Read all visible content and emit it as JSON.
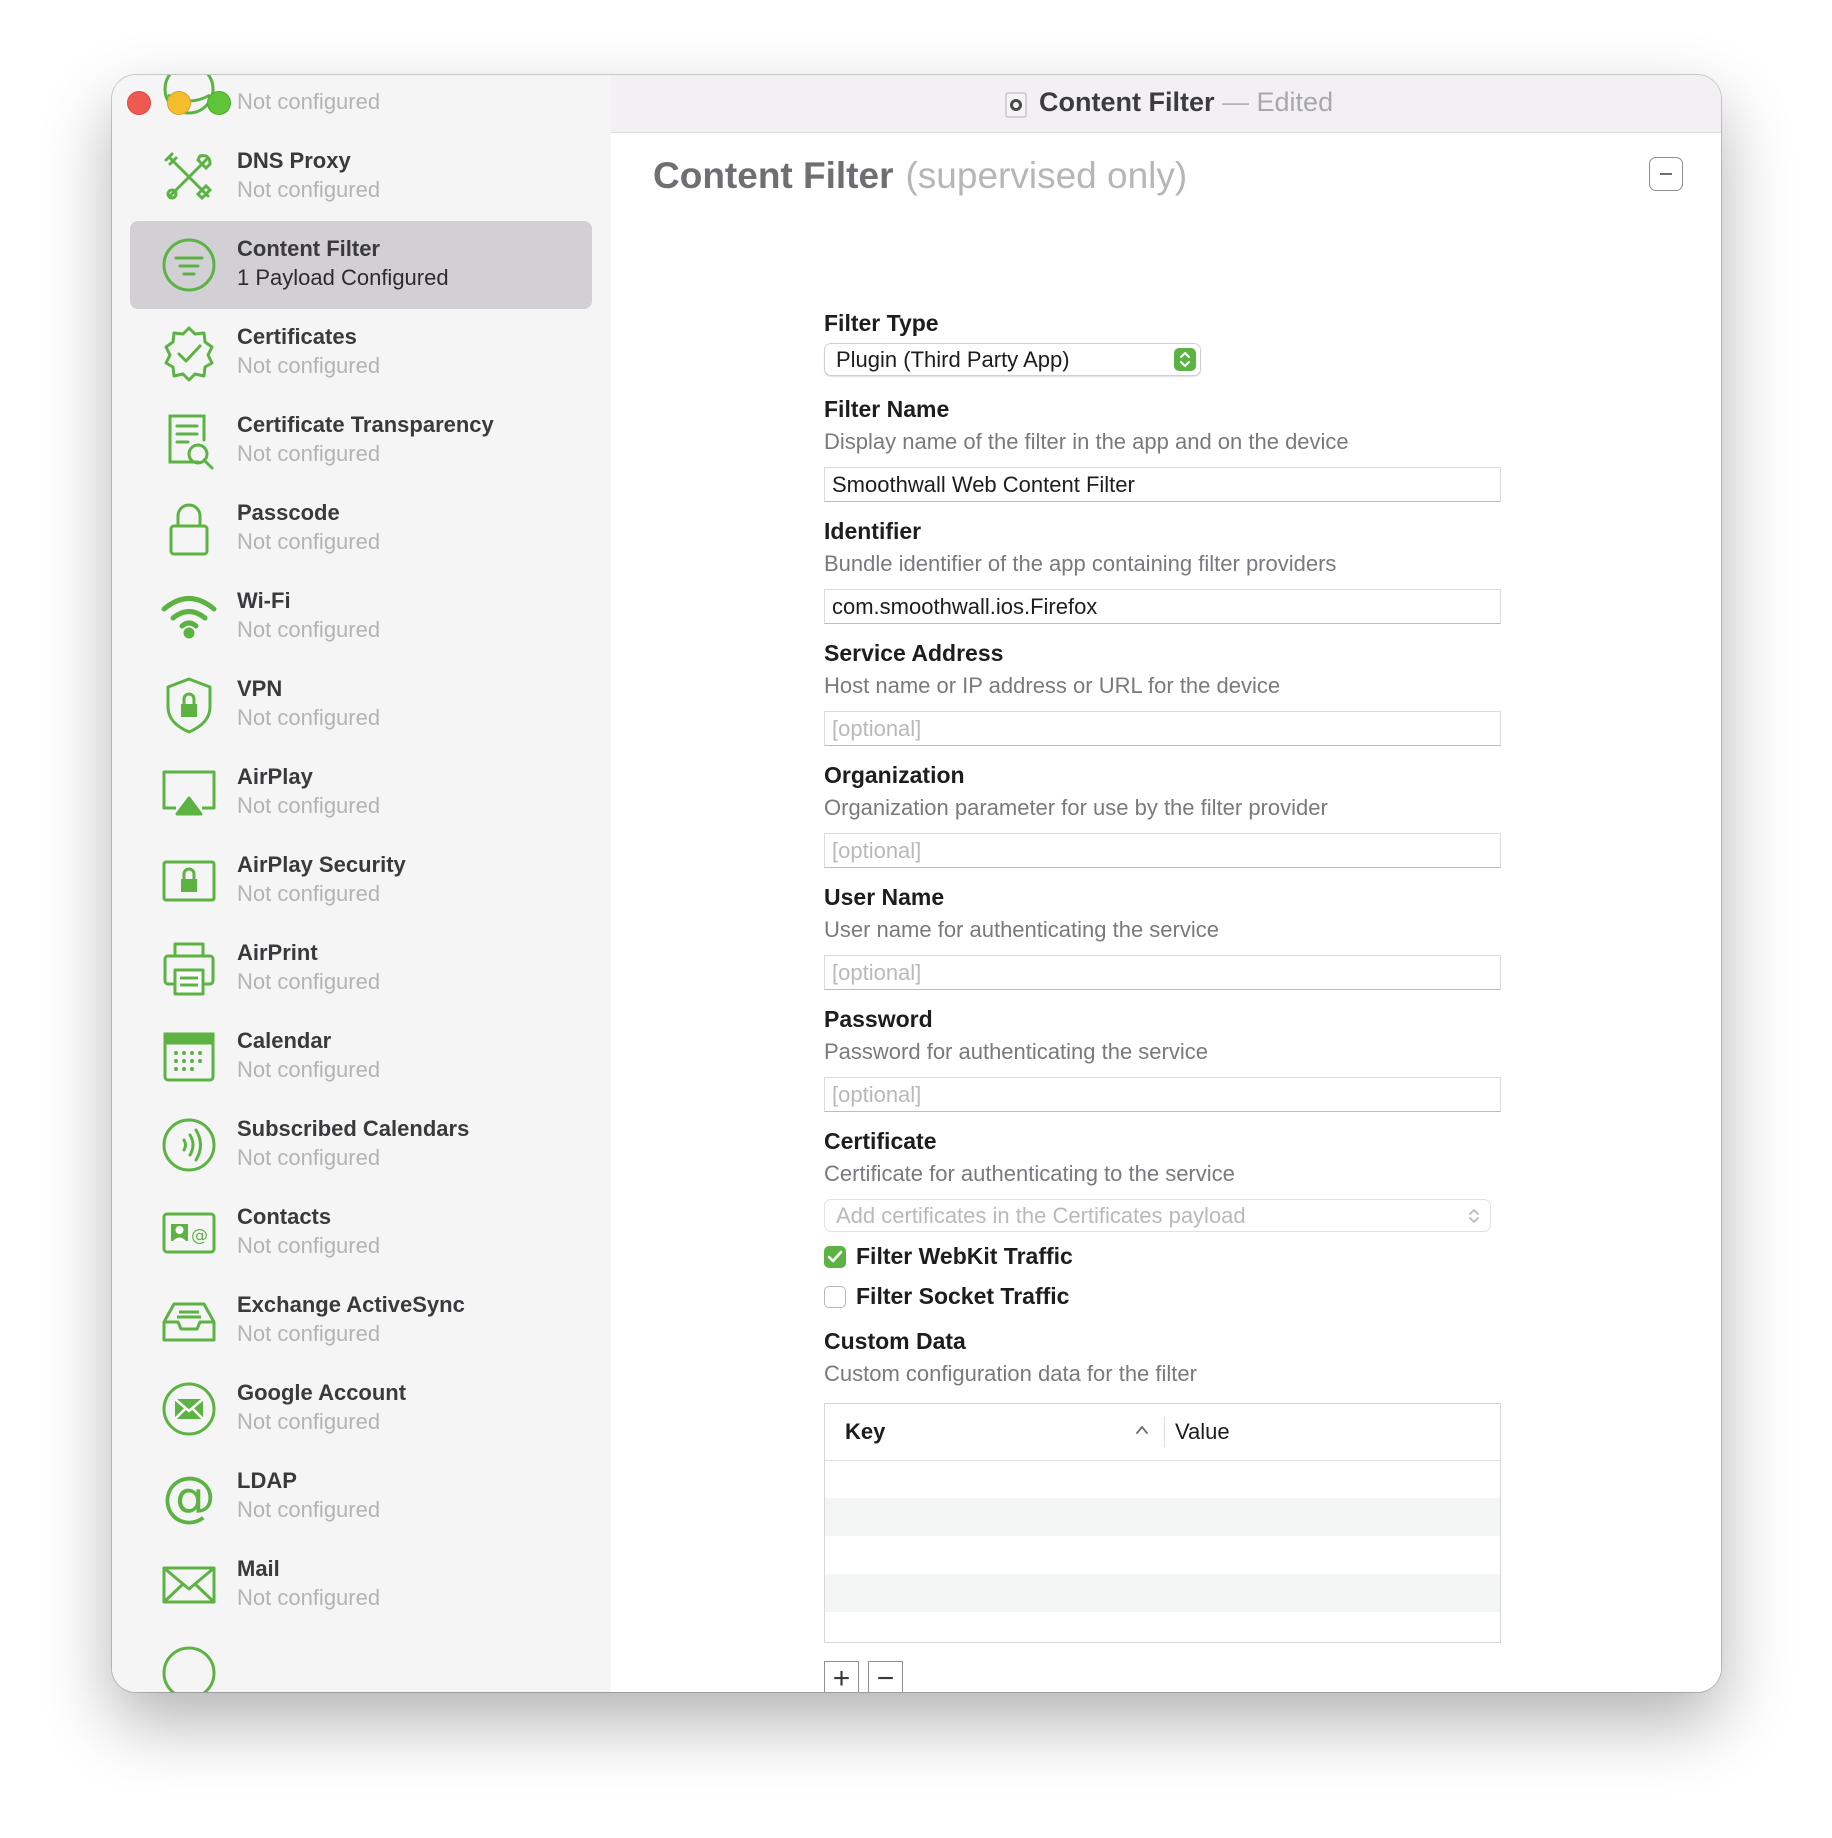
{
  "window": {
    "title": "Content Filter",
    "title_separator": "—",
    "title_status": "Edited"
  },
  "sidebar": {
    "partial_top_status": "Not configured",
    "items": [
      {
        "name": "DNS Proxy",
        "status": "Not configured",
        "icon": "dns-proxy-icon"
      },
      {
        "name": "Content Filter",
        "status": "1 Payload Configured",
        "icon": "content-filter-icon",
        "selected": true
      },
      {
        "name": "Certificates",
        "status": "Not configured",
        "icon": "certificates-icon"
      },
      {
        "name": "Certificate Transparency",
        "status": "Not configured",
        "icon": "certificate-transparency-icon"
      },
      {
        "name": "Passcode",
        "status": "Not configured",
        "icon": "passcode-icon"
      },
      {
        "name": "Wi-Fi",
        "status": "Not configured",
        "icon": "wifi-icon"
      },
      {
        "name": "VPN",
        "status": "Not configured",
        "icon": "vpn-icon"
      },
      {
        "name": "AirPlay",
        "status": "Not configured",
        "icon": "airplay-icon"
      },
      {
        "name": "AirPlay Security",
        "status": "Not configured",
        "icon": "airplay-security-icon"
      },
      {
        "name": "AirPrint",
        "status": "Not configured",
        "icon": "airprint-icon"
      },
      {
        "name": "Calendar",
        "status": "Not configured",
        "icon": "calendar-icon"
      },
      {
        "name": "Subscribed Calendars",
        "status": "Not configured",
        "icon": "subscribed-calendars-icon"
      },
      {
        "name": "Contacts",
        "status": "Not configured",
        "icon": "contacts-icon"
      },
      {
        "name": "Exchange ActiveSync",
        "status": "Not configured",
        "icon": "exchange-activesync-icon"
      },
      {
        "name": "Google Account",
        "status": "Not configured",
        "icon": "google-account-icon"
      },
      {
        "name": "LDAP",
        "status": "Not configured",
        "icon": "ldap-icon"
      },
      {
        "name": "Mail",
        "status": "Not configured",
        "icon": "mail-icon"
      }
    ]
  },
  "main": {
    "title": "Content Filter",
    "subtitle": "(supervised only)",
    "filter_type": {
      "label": "Filter Type",
      "value": "Plugin (Third Party App)"
    },
    "filter_name": {
      "label": "Filter Name",
      "description": "Display name of the filter in the app and on the device",
      "value": "Smoothwall Web Content Filter"
    },
    "identifier": {
      "label": "Identifier",
      "description": "Bundle identifier of the app containing filter providers",
      "value": "com.smoothwall.ios.Firefox"
    },
    "service_address": {
      "label": "Service Address",
      "description": "Host name or IP address or URL for the device",
      "placeholder": "[optional]"
    },
    "organization": {
      "label": "Organization",
      "description": "Organization parameter for use by the filter provider",
      "placeholder": "[optional]"
    },
    "user_name": {
      "label": "User Name",
      "description": "User name for authenticating the service",
      "placeholder": "[optional]"
    },
    "password": {
      "label": "Password",
      "description": "Password for authenticating the service",
      "placeholder": "[optional]"
    },
    "certificate": {
      "label": "Certificate",
      "description": "Certificate for authenticating to the service",
      "placeholder": "Add certificates in the Certificates payload"
    },
    "filter_webkit": {
      "label": "Filter WebKit Traffic",
      "checked": true
    },
    "filter_socket": {
      "label": "Filter Socket Traffic",
      "checked": false
    },
    "custom_data": {
      "label": "Custom Data",
      "description": "Custom configuration data for the filter",
      "columns": [
        "Key",
        "Value"
      ],
      "rows": []
    },
    "add_button": "+",
    "remove_button": "−"
  },
  "colors": {
    "accent": "#5cb343",
    "selected_row": "#d2d0d5"
  }
}
